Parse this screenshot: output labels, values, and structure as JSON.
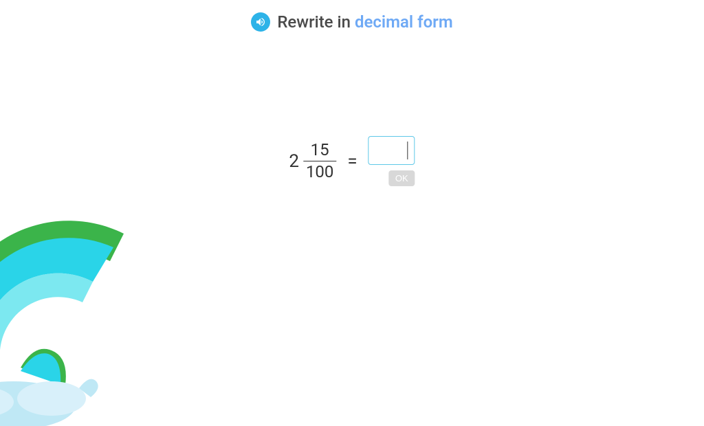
{
  "header": {
    "prompt_prefix": "Rewrite in ",
    "prompt_highlight": "decimal form"
  },
  "equation": {
    "whole": "2",
    "numerator": "15",
    "denominator": "100",
    "equals": "=",
    "answer_value": ""
  },
  "buttons": {
    "ok": "OK"
  }
}
